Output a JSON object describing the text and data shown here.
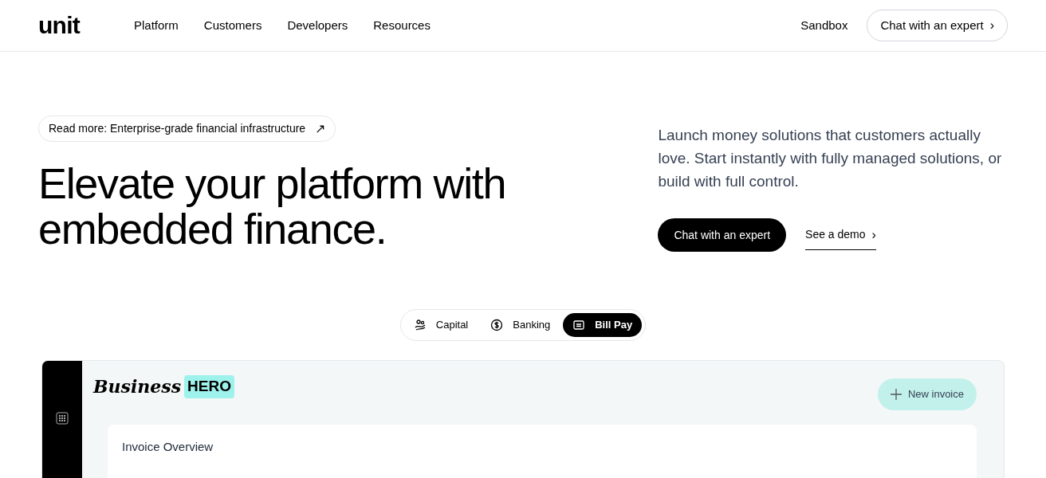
{
  "header": {
    "logo": "unit",
    "nav": [
      "Platform",
      "Customers",
      "Developers",
      "Resources"
    ],
    "sandbox": "Sandbox",
    "cta": "Chat with an expert",
    "cta_icon": "›"
  },
  "hero": {
    "announcement": "Read more: Enterprise-grade financial infrastructure",
    "announcement_icon": "↗",
    "headline": "Elevate your platform with embedded finance.",
    "description": "Launch money solutions that customers actually love. Start instantly with fully managed solutions, or build with full control.",
    "primary_button": "Chat with an expert",
    "secondary_link": "See a demo",
    "secondary_icon": "›"
  },
  "product_tabs": [
    {
      "label": "Capital",
      "selected": false
    },
    {
      "label": "Banking",
      "selected": false
    },
    {
      "label": "Bill Pay",
      "selected": true
    }
  ],
  "preview": {
    "brand_script": "Business",
    "brand_badge": "HERO",
    "new_button": "New invoice",
    "card_title": "Invoice Overview"
  }
}
